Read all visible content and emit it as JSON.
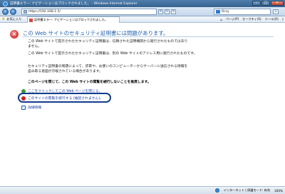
{
  "window": {
    "title": "証明書エラー: ナビゲーションはブロックされました。 - Windows Internet Explorer"
  },
  "address_bar": {
    "url": "https://192.168.1.5/",
    "search_text": "Bing"
  },
  "command_bar": {
    "favorites_label": "お気に入り",
    "tab_label": "証明書エラー: ナビゲーションはブロックされました。",
    "items": [
      "ページ(P)",
      "セーフティ(S)",
      "ツール(O)"
    ]
  },
  "content": {
    "heading": "この Web サイトのセキュリティ証明書には問題があります。",
    "para1_line1": "この Web サイトで提示されたセキュリティ証明書は、信頼された証明機関から発行されたものではあり",
    "para1_line2": "ません。",
    "para1_line3": "この Web サイトで提示されたセキュリティ証明書は、別の Web サイトのアドレス用に発行されたものです。",
    "para2_line1": "セキュリティ証明書の問題によって、詐欺や、お使いのコンピューターからサーバーに送信される情報を",
    "para2_line2": "盗み取る意図が示唆されている場合があります。",
    "recommendation": "このページを閉じて、この Web サイトの閲覧を続行しないことを推奨します。",
    "link_close": "ここをクリックしてこの Web ページを閉じる。",
    "link_continue": "このサイトの閲覧を続行する (推奨されません)。",
    "link_info": "詳細情報"
  },
  "status_bar": {
    "zone": "インターネット | 保護モード: 有効",
    "zoom": "100%"
  }
}
